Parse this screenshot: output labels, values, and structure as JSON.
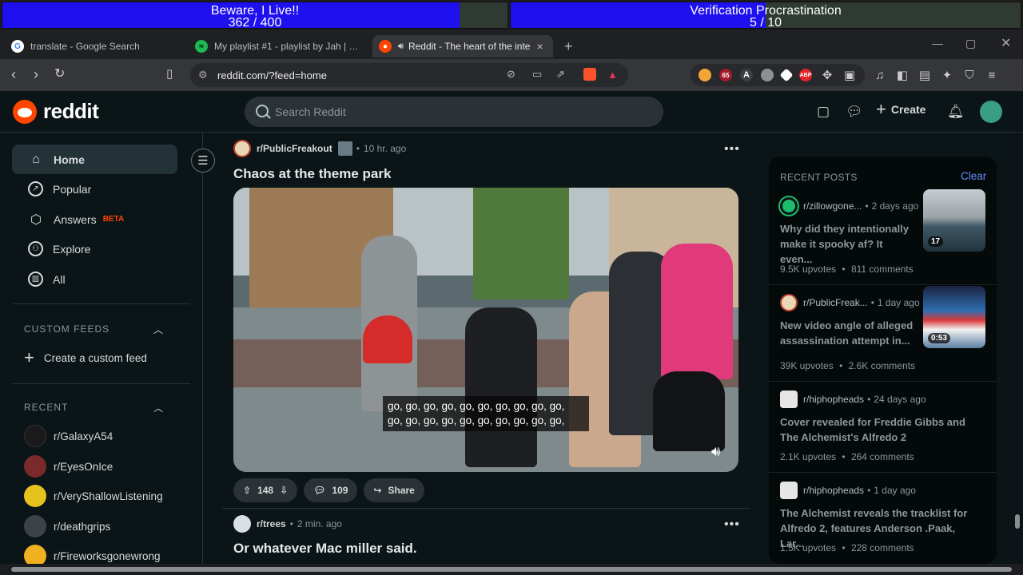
{
  "progress": [
    {
      "title": "Beware, I Live!!",
      "count": "362 / 400",
      "fraction": 0.905
    },
    {
      "title": "Verification Procrastination",
      "count": "5 / 10",
      "fraction": 0.5
    }
  ],
  "browser": {
    "tabs": [
      {
        "label": "translate - Google Search",
        "active": false
      },
      {
        "label": "My playlist #1 - playlist by Jah | Spoti",
        "active": false
      },
      {
        "label": "Reddit - The heart of the inte",
        "active": true
      }
    ],
    "url": "reddit.com/?feed=home",
    "ext_badge": "65"
  },
  "reddit": {
    "logo_text": "reddit",
    "search_placeholder": "Search Reddit",
    "create_label": "Create"
  },
  "sidebar": {
    "nav": [
      {
        "label": "Home",
        "icon": "home-icon"
      },
      {
        "label": "Popular",
        "icon": "popular-icon"
      },
      {
        "label": "Answers",
        "icon": "answers-icon",
        "badge": "BETA"
      },
      {
        "label": "Explore",
        "icon": "explore-icon"
      },
      {
        "label": "All",
        "icon": "all-icon"
      }
    ],
    "custom_feeds_header": "CUSTOM FEEDS",
    "create_feed_label": "Create a custom feed",
    "recent_header": "RECENT",
    "recent": [
      {
        "label": "r/GalaxyA54",
        "color": "#1a1a1a"
      },
      {
        "label": "r/EyesOnIce",
        "color": "#7a2a2a"
      },
      {
        "label": "r/VeryShallowListening",
        "color": "#e6c21f"
      },
      {
        "label": "r/deathgrips",
        "color": "#3b4346"
      },
      {
        "label": "r/Fireworksgonewrong",
        "color": "#f0b020"
      }
    ]
  },
  "feed": {
    "posts": [
      {
        "subreddit": "r/PublicFreakout",
        "time": "10 hr. ago",
        "title": "Chaos at the theme park",
        "caption_line1": "go, go, go, go, go, go, go, go, go, go,",
        "caption_line2": "go, go, go, go, go, go, go, go, go, go,",
        "upvotes": "148",
        "comments": "109",
        "share_label": "Share"
      },
      {
        "subreddit": "r/trees",
        "time": "2 min. ago",
        "title": "Or whatever Mac miller said."
      }
    ]
  },
  "recent_posts": {
    "header": "RECENT POSTS",
    "clear_label": "Clear",
    "items": [
      {
        "subreddit": "r/zillowgone...",
        "time": "2 days ago",
        "title": "Why did they intentionally make it spooky af? It even...",
        "upvotes": "9.5K upvotes",
        "comments": "811 comments",
        "thumb_badge": "17"
      },
      {
        "subreddit": "r/PublicFreak...",
        "time": "1 day ago",
        "title": "New video angle of alleged assassination attempt in...",
        "upvotes": "39K upvotes",
        "comments": "2.6K comments",
        "thumb_badge": "0:53"
      },
      {
        "subreddit": "r/hiphopheads",
        "time": "24 days ago",
        "title": "Cover revealed for Freddie Gibbs and The Alchemist's Alfredo 2",
        "upvotes": "2.1K upvotes",
        "comments": "264 comments"
      },
      {
        "subreddit": "r/hiphopheads",
        "time": "1 day ago",
        "title": "The Alchemist reveals the tracklist for Alfredo 2, features Anderson .Paak, Lar...",
        "upvotes": "1.5K upvotes",
        "comments": "228 comments"
      }
    ]
  }
}
